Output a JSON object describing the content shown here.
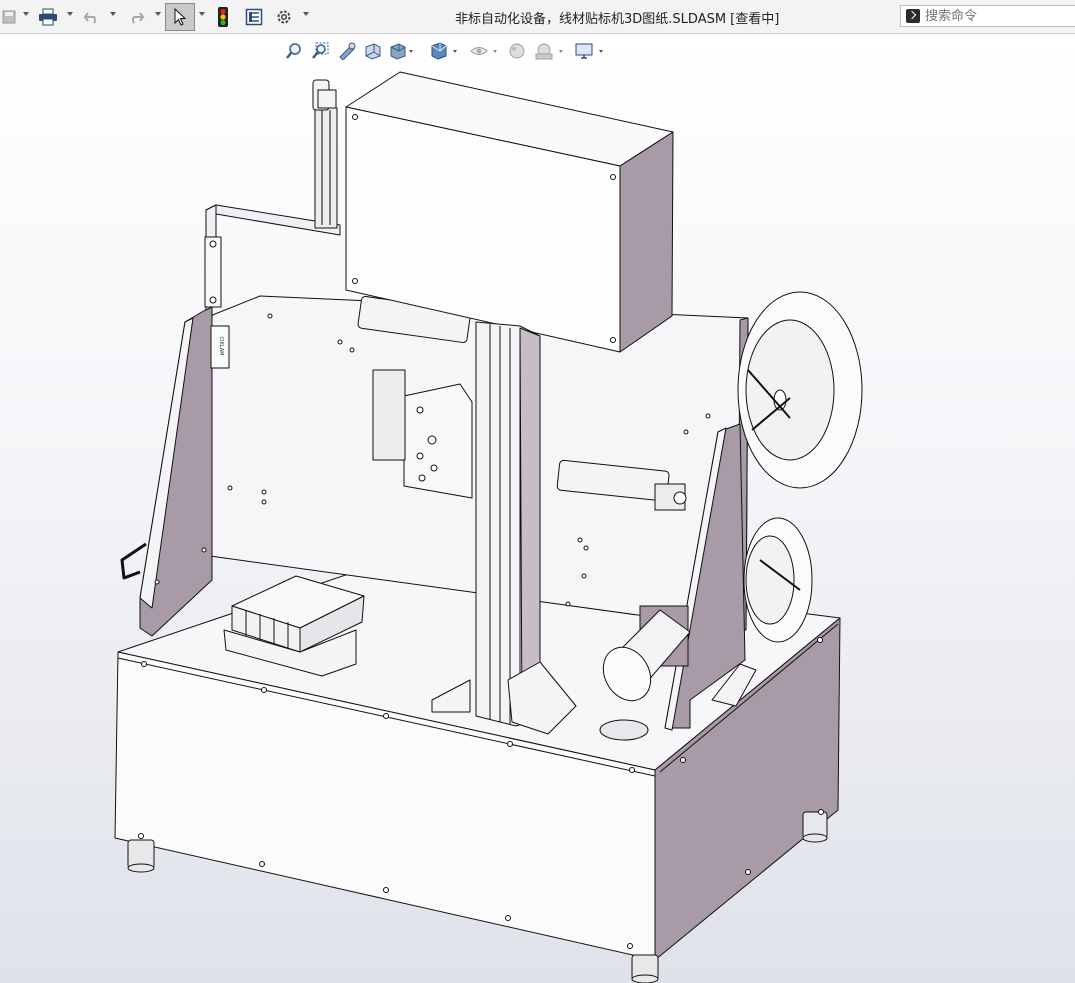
{
  "titlebar": {
    "title": "非标自动化设备，线材贴标机3D图纸.SLDASM [查看中]",
    "buttons": [
      {
        "name": "save-icon"
      },
      {
        "name": "print-icon"
      },
      {
        "name": "undo-icon"
      },
      {
        "name": "redo-icon"
      },
      {
        "name": "select-pointer-icon"
      },
      {
        "name": "rebuild-traffic-light-icon"
      },
      {
        "name": "file-properties-icon"
      },
      {
        "name": "options-gear-icon"
      }
    ]
  },
  "search": {
    "placeholder": "搜索命令"
  },
  "headsup_toolbar": [
    {
      "name": "zoom-to-fit-icon"
    },
    {
      "name": "zoom-to-area-icon"
    },
    {
      "name": "previous-view-icon"
    },
    {
      "name": "section-view-icon"
    },
    {
      "name": "view-orientation-icon"
    },
    {
      "name": "display-style-icon"
    },
    {
      "name": "hide-show-items-icon"
    },
    {
      "name": "edit-appearance-icon"
    },
    {
      "name": "apply-scene-icon"
    },
    {
      "name": "view-settings-icon"
    }
  ],
  "colors": {
    "machine_face_light": "#f7f7f9",
    "machine_face_shadow": "#a89aa6",
    "line": "#111111",
    "viewport_bottom": "#dfe2ea"
  },
  "model": {
    "label_tag": "CIKLAM"
  }
}
